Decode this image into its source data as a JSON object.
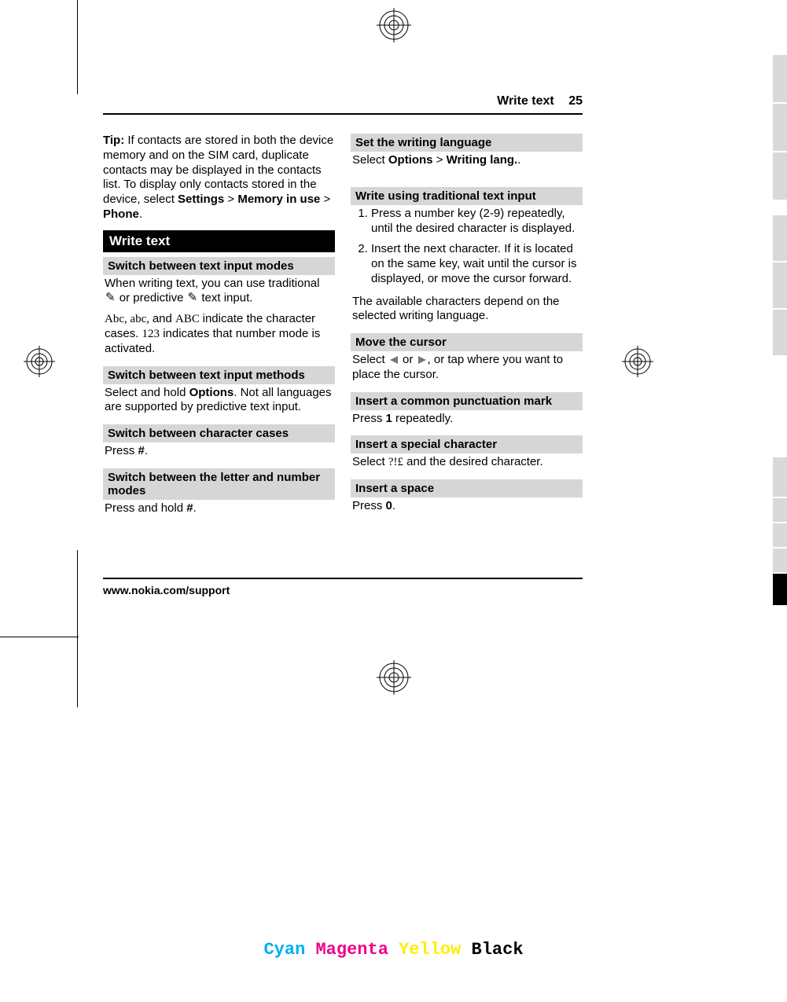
{
  "header": {
    "title": "Write text",
    "page": "25"
  },
  "left": {
    "tip_label": "Tip:",
    "tip_text": " If contacts are stored in both the device memory and on the SIM card, duplicate contacts may be displayed in the contacts list. To display only contacts stored in the device, select ",
    "settings": "Settings",
    "memory": "Memory in use",
    "phone": "Phone",
    "gt": " > ",
    "section": "Write text",
    "h1": "Switch between text input modes",
    "p1a": "When writing text, you can use traditional ",
    "p1b": " or predictive ",
    "p1c": " text input.",
    "icon_trad": "✎",
    "icon_pred": "✎",
    "p2a": "Abc, abc, ",
    "p2b": "and ",
    "p2c": "ABC ",
    "p2d": "indicate the character cases. ",
    "p2e": "123",
    "p2f": " indicates that number mode is activated.",
    "h2": "Switch between text input methods",
    "p3a": "Select and hold ",
    "options": "Options",
    "p3b": ". Not all languages are supported by predictive text input.",
    "h3": "Switch between character cases",
    "p4a": "Press ",
    "hash": "#",
    "dot": ".",
    "h4": "Switch between the letter and number modes",
    "p5a": "Press and hold "
  },
  "right": {
    "h1": "Set the writing language",
    "p1a": "Select ",
    "options": "Options",
    "gt": " > ",
    "writing": "Writing lang.",
    "dot": ".",
    "h2": "Write using traditional text input",
    "step1": "Press a number key (2-9) repeatedly, until the desired character is displayed.",
    "step2": "Insert the next character. If it is located on the same key, wait until the cursor is displayed, or move the cursor forward.",
    "p2": "The available characters depend on the selected writing language.",
    "h3": "Move the cursor",
    "p3a": "Select ",
    "p3b": " or ",
    "p3c": ", or tap where you want to place the cursor.",
    "h4": "Insert a common punctuation mark",
    "p4a": "Press ",
    "one": "1",
    "p4b": " repeatedly.",
    "h5": "Insert a special character",
    "p5a": "Select ",
    "sym": "?!£",
    "p5b": " and the desired character.",
    "h6": "Insert a space",
    "p6a": "Press ",
    "zero": "0"
  },
  "footer": "www.nokia.com/support",
  "colors": {
    "c": "Cyan",
    "m": "Magenta",
    "y": "Yellow",
    "k": "Black"
  }
}
